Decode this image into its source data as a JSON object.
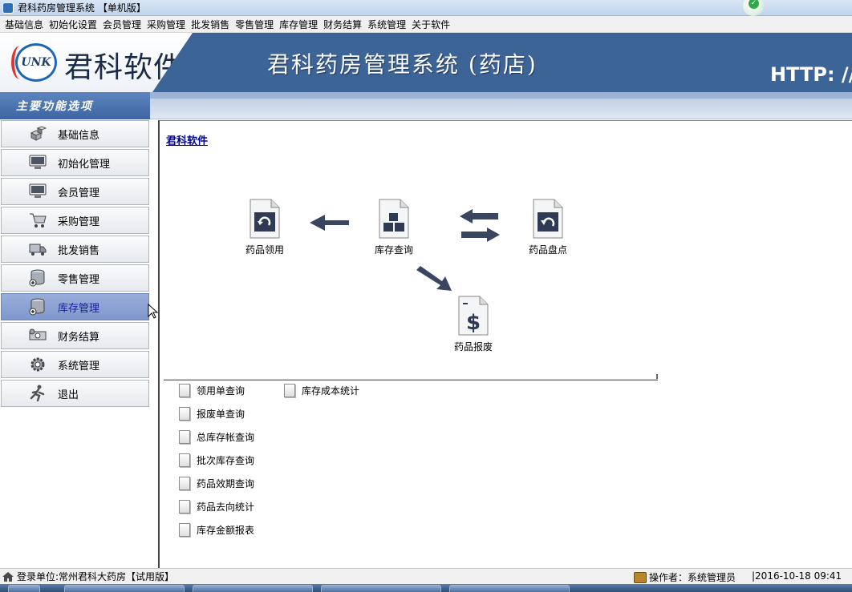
{
  "window": {
    "title": "君科药房管理系统 【单机版】"
  },
  "menu": [
    "基础信息",
    "初始化设置",
    "会员管理",
    "采购管理",
    "批发销售",
    "零售管理",
    "库存管理",
    "财务结算",
    "系统管理",
    "关于软件"
  ],
  "banner": {
    "logo_mark": "UNK",
    "logo_text": "君科软件",
    "title": "君科药房管理系统 (药店)",
    "url": "HTTP: //"
  },
  "sidebar": {
    "header": "主要功能选项",
    "items": [
      {
        "label": "基础信息",
        "icon": "cubes-icon"
      },
      {
        "label": "初始化管理",
        "icon": "monitor-icon"
      },
      {
        "label": "会员管理",
        "icon": "monitor-icon"
      },
      {
        "label": "采购管理",
        "icon": "cart-icon"
      },
      {
        "label": "批发销售",
        "icon": "truck-icon"
      },
      {
        "label": "零售管理",
        "icon": "database-add-icon"
      },
      {
        "label": "库存管理",
        "icon": "database-add-icon",
        "active": true
      },
      {
        "label": "财务结算",
        "icon": "money-icon"
      },
      {
        "label": "系统管理",
        "icon": "gear-icon"
      },
      {
        "label": "退出",
        "icon": "exit-runner-icon"
      }
    ]
  },
  "content": {
    "breadcrumb": "君科软件",
    "flow": {
      "drug_requisition": "药品领用",
      "inventory_query": "库存查询",
      "drug_stocktake": "药品盘点",
      "drug_scrap": "药品报废"
    },
    "links": [
      "领用单查询",
      "报废单查询",
      "总库存帐查询",
      "批次库存查询",
      "药品效期查询",
      "药品去向统计",
      "库存金额报表",
      "库存成本统计"
    ]
  },
  "status": {
    "login_unit": "登录单位:常州君科大药房【试用版】",
    "operator": "操作者：系统管理员",
    "datetime": "|2016-10-18 09:41"
  },
  "colors": {
    "banner_blue": "#3d6496",
    "active_nav": "#8ea3d4",
    "link_blue": "#000099",
    "arrow_navy": "#3a4660"
  }
}
